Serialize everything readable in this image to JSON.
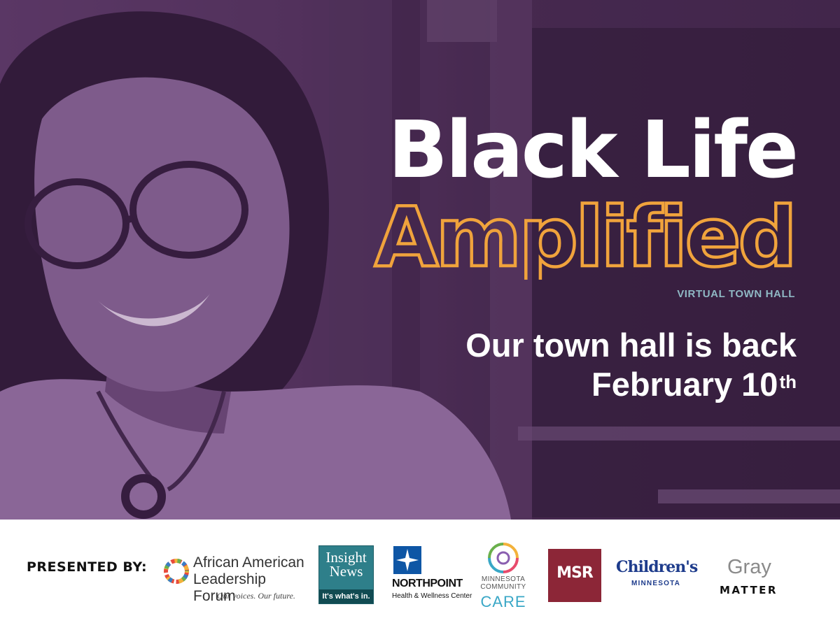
{
  "hero": {
    "title_line1": "Black Life",
    "title_line2": "Amplified",
    "subtitle": "VIRTUAL TOWN HALL",
    "announcement_line1": "Our town hall is back",
    "announcement_line2": "February 10",
    "announcement_suffix": "th"
  },
  "colors": {
    "purple": "#4f3257",
    "accent_orange": "#f0a33c",
    "subtitle_teal": "#8fb8c4"
  },
  "footer": {
    "presented_by": "PRESENTED BY:",
    "sponsors": {
      "aalf": {
        "name": "African American Leadership Forum",
        "tagline": "Our voices. Our future."
      },
      "insight": {
        "name": "Insight News",
        "tagline": "It's what's in."
      },
      "northpoint": {
        "name": "NORTHPOINT",
        "subtitle": "Health & Wellness Center"
      },
      "mcc": {
        "name": "MINNESOTA COMMUNITY",
        "care": "CARE"
      },
      "msr": {
        "name": "MSR"
      },
      "childrens": {
        "name": "Children's",
        "subtitle": "MINNESOTA"
      },
      "graymatter": {
        "line1": "Gray",
        "line2": "MATTER"
      }
    }
  }
}
